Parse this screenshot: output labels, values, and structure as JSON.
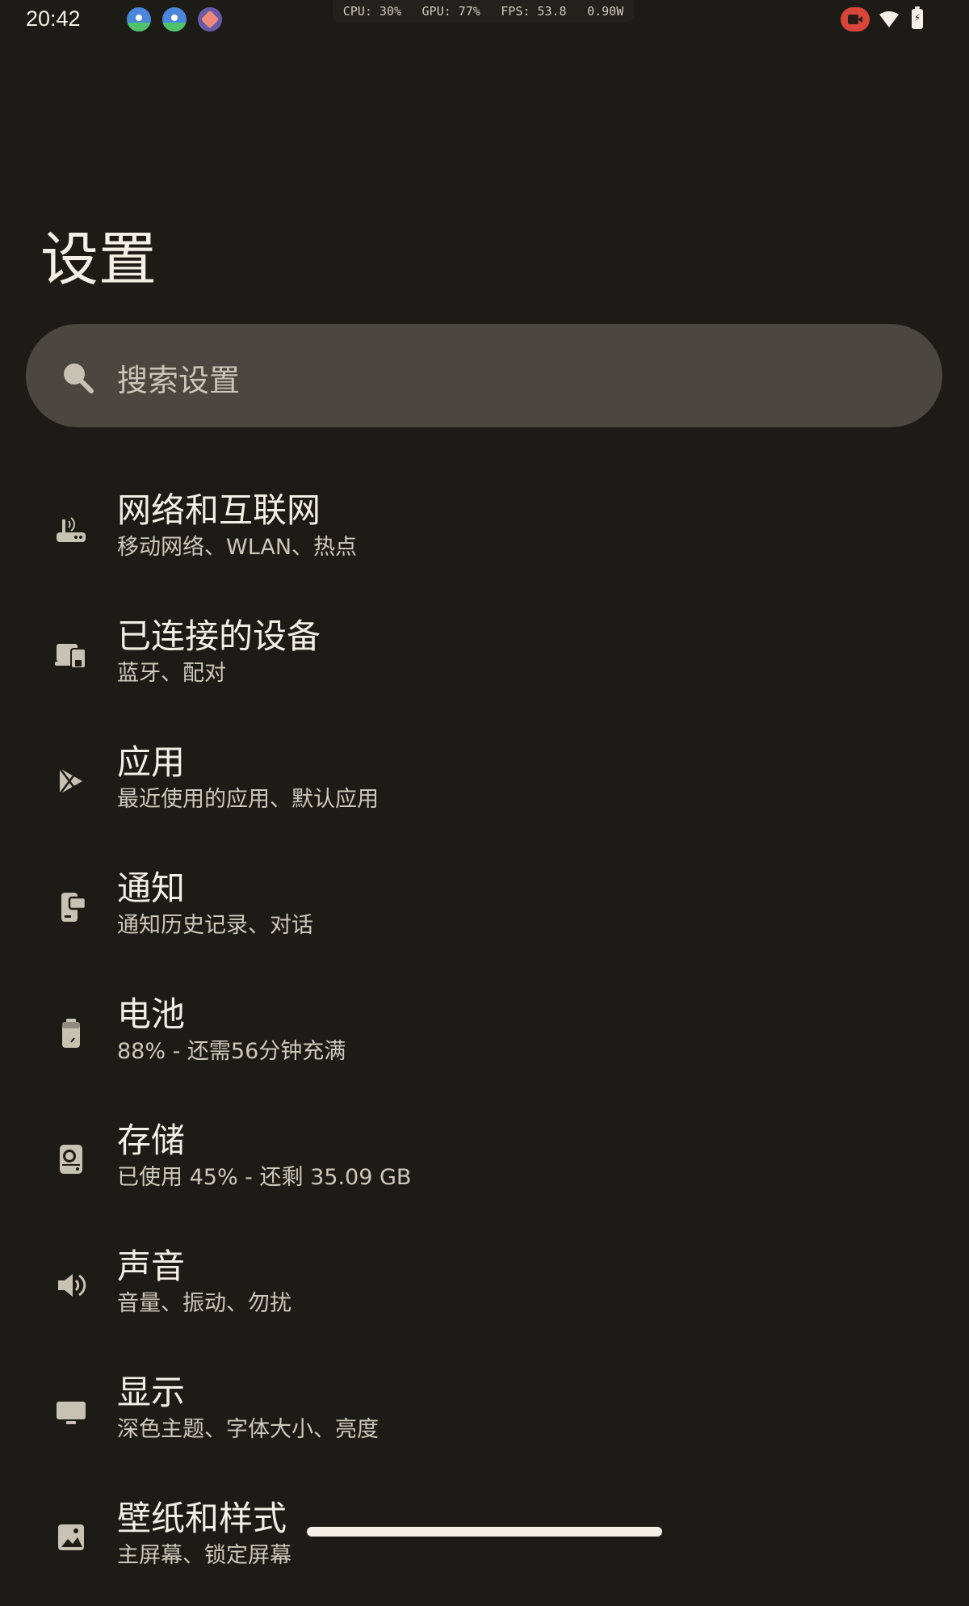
{
  "status_bar": {
    "time": "20:42",
    "perf": {
      "cpu": "CPU: 30%",
      "gpu": "GPU: 77%",
      "fps": "FPS: 53.8",
      "power": "0.90W"
    },
    "notification_icons": [
      "app-icon-blue",
      "app-icon-blue",
      "screen-rotate-icon"
    ],
    "right_icons": [
      "screen-record-icon",
      "wifi-icon",
      "battery-charging-icon"
    ]
  },
  "page": {
    "title": "设置"
  },
  "search": {
    "placeholder": "搜索设置"
  },
  "items": [
    {
      "title": "网络和互联网",
      "subtitle": "移动网络、WLAN、热点",
      "icon": "router-icon"
    },
    {
      "title": "已连接的设备",
      "subtitle": "蓝牙、配对",
      "icon": "devices-icon"
    },
    {
      "title": "应用",
      "subtitle": "最近使用的应用、默认应用",
      "icon": "apps-icon"
    },
    {
      "title": "通知",
      "subtitle": "通知历史记录、对话",
      "icon": "notification-icon"
    },
    {
      "title": "电池",
      "subtitle": "88% - 还需56分钟充满",
      "icon": "battery-icon"
    },
    {
      "title": "存储",
      "subtitle": "已使用 45% - 还剩 35.09 GB",
      "icon": "storage-icon"
    },
    {
      "title": "声音",
      "subtitle": "音量、振动、勿扰",
      "icon": "sound-icon"
    },
    {
      "title": "显示",
      "subtitle": "深色主题、字体大小、亮度",
      "icon": "display-icon"
    },
    {
      "title": "壁纸和样式",
      "subtitle": "主屏幕、锁定屏幕",
      "icon": "wallpaper-icon"
    }
  ],
  "colors": {
    "background": "#1c1b16",
    "search_background": "#4a4740",
    "icon": "#c8c2b2",
    "record_badge": "#d8463a"
  }
}
